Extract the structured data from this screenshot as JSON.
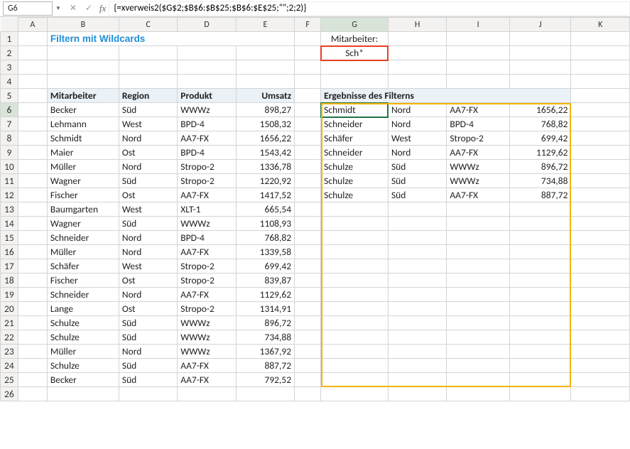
{
  "nameBox": "G6",
  "formula": "{=xverweis2($G$2;$B$6:$B$25;$B$6:$E$25;\"\";2;2)}",
  "title": "Filtern mit Wildcards",
  "filterLabel": "Mitarbeiter:",
  "filterValue": "Sch*",
  "headers": {
    "b": "Mitarbeiter",
    "c": "Region",
    "d": "Produkt",
    "e": "Umsatz"
  },
  "resultHeader": "Ergebnisse des Filterns",
  "source": [
    {
      "b": "Becker",
      "c": "Süd",
      "d": "WWWz",
      "e": "898,27"
    },
    {
      "b": "Lehmann",
      "c": "West",
      "d": "BPD-4",
      "e": "1508,32"
    },
    {
      "b": "Schmidt",
      "c": "Nord",
      "d": "AA7-FX",
      "e": "1656,22"
    },
    {
      "b": "Maier",
      "c": "Ost",
      "d": "BPD-4",
      "e": "1543,42"
    },
    {
      "b": "Müller",
      "c": "Nord",
      "d": "Stropo-2",
      "e": "1336,78"
    },
    {
      "b": "Wagner",
      "c": "Süd",
      "d": "Stropo-2",
      "e": "1220,92"
    },
    {
      "b": "Fischer",
      "c": "Ost",
      "d": "AA7-FX",
      "e": "1417,52"
    },
    {
      "b": "Baumgarten",
      "c": "West",
      "d": "XLT-1",
      "e": "665,54"
    },
    {
      "b": "Wagner",
      "c": "Süd",
      "d": "WWWz",
      "e": "1108,93"
    },
    {
      "b": "Schneider",
      "c": "Nord",
      "d": "BPD-4",
      "e": "768,82"
    },
    {
      "b": "Müller",
      "c": "Nord",
      "d": "AA7-FX",
      "e": "1339,58"
    },
    {
      "b": "Schäfer",
      "c": "West",
      "d": "Stropo-2",
      "e": "699,42"
    },
    {
      "b": "Fischer",
      "c": "Ost",
      "d": "Stropo-2",
      "e": "839,87"
    },
    {
      "b": "Schneider",
      "c": "Nord",
      "d": "AA7-FX",
      "e": "1129,62"
    },
    {
      "b": "Lange",
      "c": "Ost",
      "d": "Stropo-2",
      "e": "1314,91"
    },
    {
      "b": "Schulze",
      "c": "Süd",
      "d": "WWWz",
      "e": "896,72"
    },
    {
      "b": "Schulze",
      "c": "Süd",
      "d": "WWWz",
      "e": "734,88"
    },
    {
      "b": "Müller",
      "c": "Nord",
      "d": "WWWz",
      "e": "1367,92"
    },
    {
      "b": "Schulze",
      "c": "Süd",
      "d": "AA7-FX",
      "e": "887,72"
    },
    {
      "b": "Becker",
      "c": "Süd",
      "d": "AA7-FX",
      "e": "792,52"
    }
  ],
  "results": [
    {
      "g": "Schmidt",
      "h": "Nord",
      "i": "AA7-FX",
      "j": "1656,22"
    },
    {
      "g": "Schneider",
      "h": "Nord",
      "i": "BPD-4",
      "j": "768,82"
    },
    {
      "g": "Schäfer",
      "h": "West",
      "i": "Stropo-2",
      "j": "699,42"
    },
    {
      "g": "Schneider",
      "h": "Nord",
      "i": "AA7-FX",
      "j": "1129,62"
    },
    {
      "g": "Schulze",
      "h": "Süd",
      "i": "WWWz",
      "j": "896,72"
    },
    {
      "g": "Schulze",
      "h": "Süd",
      "i": "WWWz",
      "j": "734,88"
    },
    {
      "g": "Schulze",
      "h": "Süd",
      "i": "AA7-FX",
      "j": "887,72"
    }
  ],
  "cols": [
    "A",
    "B",
    "C",
    "D",
    "E",
    "F",
    "G",
    "H",
    "I",
    "J",
    "K"
  ]
}
